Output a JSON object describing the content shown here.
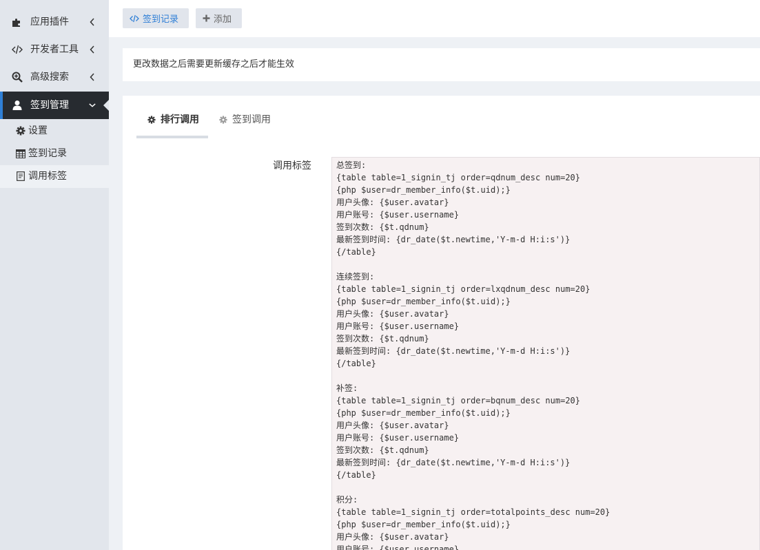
{
  "sidebar": {
    "items": [
      {
        "label": "应用插件",
        "icon": "puzzle-icon"
      },
      {
        "label": "开发者工具",
        "icon": "code-icon"
      },
      {
        "label": "高级搜索",
        "icon": "search-plus-icon"
      },
      {
        "label": "签到管理",
        "icon": "user-icon"
      }
    ],
    "subitems": [
      {
        "label": "设置",
        "icon": "gear-icon"
      },
      {
        "label": "签到记录",
        "icon": "table-icon"
      },
      {
        "label": "调用标签",
        "icon": "document-icon"
      }
    ]
  },
  "toolbar": {
    "record_label": "签到记录",
    "add_label": "添加"
  },
  "notice": "更改数据之后需要更新缓存之后才能生效",
  "tabs": [
    {
      "label": "排行调用"
    },
    {
      "label": "签到调用"
    }
  ],
  "form": {
    "label": "调用标签",
    "code": "总签到:\n{table table=1_signin_tj order=qdnum_desc num=20}\n{php $user=dr_member_info($t.uid);}\n用户头像: {$user.avatar}\n用户账号: {$user.username}\n签到次数: {$t.qdnum}\n最新签到时间: {dr_date($t.newtime,'Y-m-d H:i:s')}\n{/table}\n\n连续签到:\n{table table=1_signin_tj order=lxqdnum_desc num=20}\n{php $user=dr_member_info($t.uid);}\n用户头像: {$user.avatar}\n用户账号: {$user.username}\n签到次数: {$t.qdnum}\n最新签到时间: {dr_date($t.newtime,'Y-m-d H:i:s')}\n{/table}\n\n补签:\n{table table=1_signin_tj order=bqnum_desc num=20}\n{php $user=dr_member_info($t.uid);}\n用户头像: {$user.avatar}\n用户账号: {$user.username}\n签到次数: {$t.qdnum}\n最新签到时间: {dr_date($t.newtime,'Y-m-d H:i:s')}\n{/table}\n\n积分:\n{table table=1_signin_tj order=totalpoints_desc num=20}\n{php $user=dr_member_info($t.uid);}\n用户头像: {$user.avatar}\n用户账号: {$user.username}"
  },
  "colors": {
    "accent": "#2f7fd6",
    "sidebar_bg": "#e2e6ec",
    "active_bg": "#272b30",
    "code_bg": "#f7f1f2"
  }
}
